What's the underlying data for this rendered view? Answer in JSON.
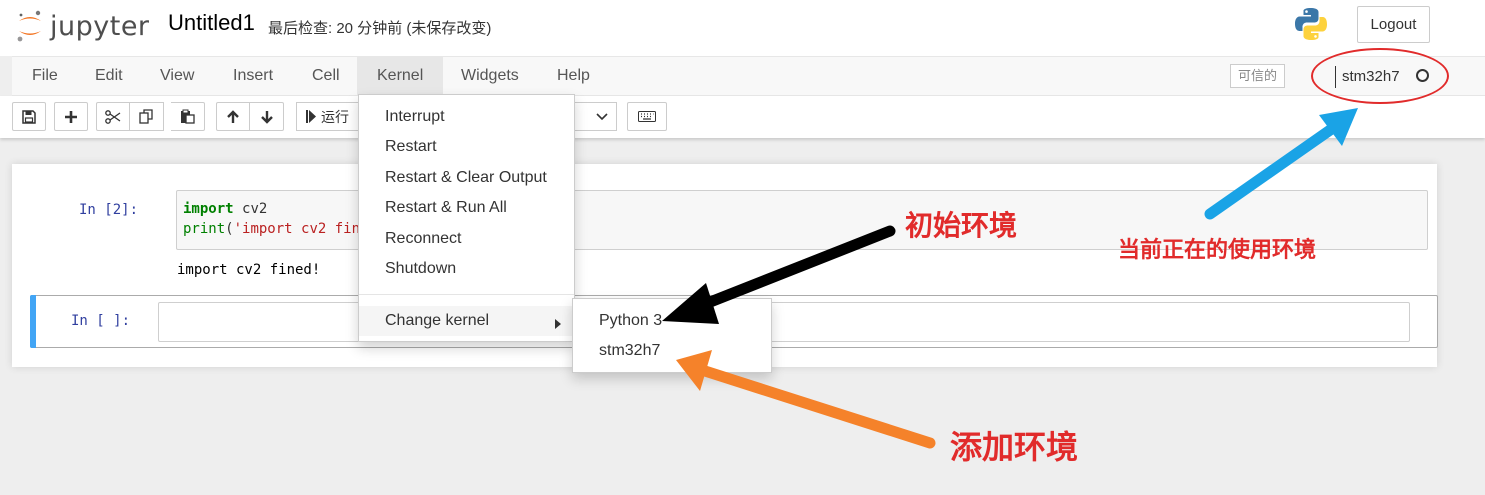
{
  "header": {
    "logo_text": "jupyter",
    "notebook_name": "Untitled1",
    "checkpoint": "最后检查: 20 分钟前  (未保存改变)",
    "logout_label": "Logout"
  },
  "menubar": {
    "items": [
      "File",
      "Edit",
      "View",
      "Insert",
      "Cell",
      "Kernel",
      "Widgets",
      "Help"
    ],
    "active": "Kernel",
    "trusted_label": "可信的",
    "kernel_name": "stm32h7"
  },
  "toolbar": {
    "run_label": "运行"
  },
  "cells": [
    {
      "prompt": "In  [2]:",
      "code": [
        "import cv2",
        "print('import cv2 fini"
      ],
      "output": "import cv2 fined!"
    },
    {
      "prompt": "In  [ ]:",
      "code": []
    }
  ],
  "kernel_menu": {
    "items": [
      "Interrupt",
      "Restart",
      "Restart & Clear Output",
      "Restart & Run All",
      "Reconnect",
      "Shutdown"
    ],
    "change_kernel_label": "Change kernel"
  },
  "change_kernel_submenu": {
    "items": [
      "Python 3",
      "stm32h7"
    ]
  },
  "annotations": {
    "initial_env": "初始环境",
    "current_env": "当前正在的使用环境",
    "added_env": "添加环境"
  },
  "colors": {
    "annotation_red": "#e12b2b",
    "arrow_black": "#000000",
    "arrow_blue": "#1aa3e6",
    "arrow_orange": "#f5822a",
    "active_cell_bar": "#42a5f5"
  }
}
